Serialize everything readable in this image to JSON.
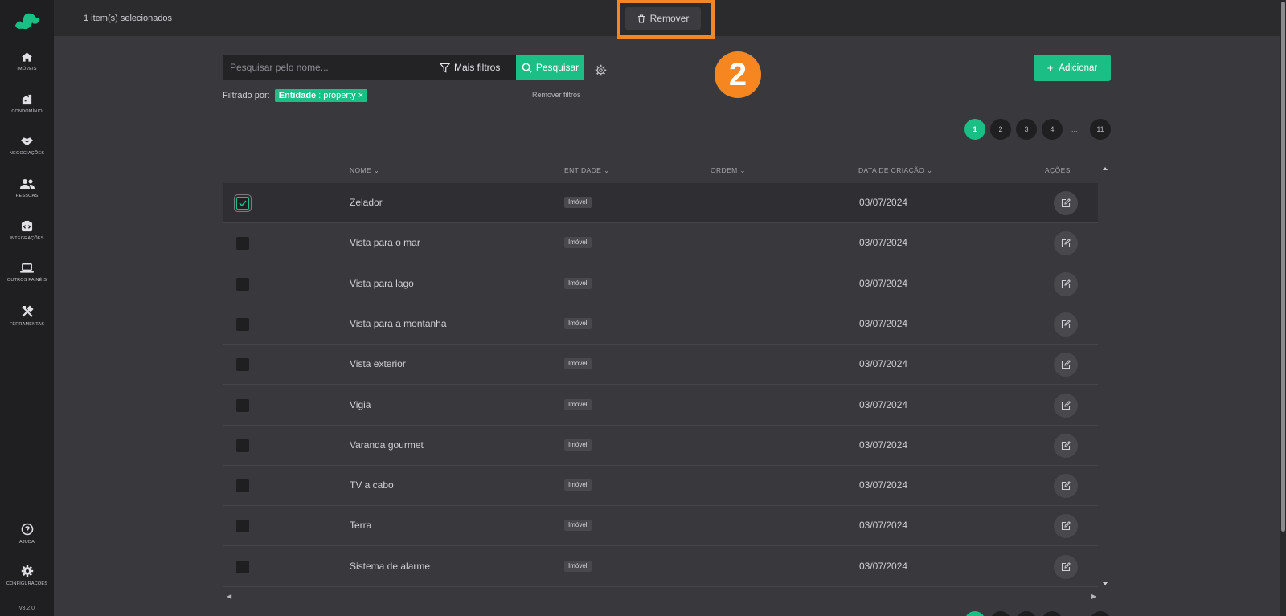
{
  "sidebar": {
    "items": [
      {
        "label": "IMÓVEIS",
        "icon": "home-icon"
      },
      {
        "label": "CONDOMÍNIO",
        "icon": "condominium-icon"
      },
      {
        "label": "NEGOCIAÇÕES",
        "icon": "handshake-icon"
      },
      {
        "label": "PESSOAS",
        "icon": "people-icon"
      },
      {
        "label": "INTEGRAÇÕES",
        "icon": "integrations-icon"
      },
      {
        "label": "OUTROS PAINÉIS",
        "icon": "laptop-icon"
      },
      {
        "label": "FERRAMENTAS",
        "icon": "tools-icon"
      }
    ],
    "help_label": "AJUDA",
    "settings_label": "CONFIGURAÇÕES",
    "version": "v3.2.0"
  },
  "topbar": {
    "selection_count": "1 item(s) selecionados",
    "remove_label": "Remover"
  },
  "annotation": {
    "step": "2",
    "color": "#f6861f"
  },
  "search": {
    "placeholder": "Pesquisar pelo nome...",
    "value": "",
    "more_filters_label": "Mais filtros",
    "search_label": "Pesquisar"
  },
  "add_label": "Adicionar",
  "filters": {
    "prefix": "Filtrado por:",
    "chip_key": "Entidade",
    "chip_value": ": property",
    "remove_all": "Remover filtros"
  },
  "pagination": {
    "pages": [
      "1",
      "2",
      "3",
      "4"
    ],
    "ellipsis": "...",
    "last": "11",
    "active": "1"
  },
  "table": {
    "columns": {
      "name": "NOME",
      "entity": "ENTIDADE",
      "order": "ORDEM",
      "created": "DATA DE CRIAÇÃO",
      "actions": "AÇÕES"
    },
    "rows": [
      {
        "name": "Zelador",
        "entity": "Imóvel",
        "order": "",
        "date": "03/07/2024",
        "checked": true
      },
      {
        "name": "Vista para o mar",
        "entity": "Imóvel",
        "order": "",
        "date": "03/07/2024",
        "checked": false
      },
      {
        "name": "Vista para lago",
        "entity": "Imóvel",
        "order": "",
        "date": "03/07/2024",
        "checked": false
      },
      {
        "name": "Vista para a montanha",
        "entity": "Imóvel",
        "order": "",
        "date": "03/07/2024",
        "checked": false
      },
      {
        "name": "Vista exterior",
        "entity": "Imóvel",
        "order": "",
        "date": "03/07/2024",
        "checked": false
      },
      {
        "name": "Vigia",
        "entity": "Imóvel",
        "order": "",
        "date": "03/07/2024",
        "checked": false
      },
      {
        "name": "Varanda gourmet",
        "entity": "Imóvel",
        "order": "",
        "date": "03/07/2024",
        "checked": false
      },
      {
        "name": "TV a cabo",
        "entity": "Imóvel",
        "order": "",
        "date": "03/07/2024",
        "checked": false
      },
      {
        "name": "Terra",
        "entity": "Imóvel",
        "order": "",
        "date": "03/07/2024",
        "checked": false
      },
      {
        "name": "Sistema de alarme",
        "entity": "Imóvel",
        "order": "",
        "date": "03/07/2024",
        "checked": false
      }
    ]
  },
  "colors": {
    "accent": "#1bbf85",
    "highlight": "#f6861f"
  }
}
